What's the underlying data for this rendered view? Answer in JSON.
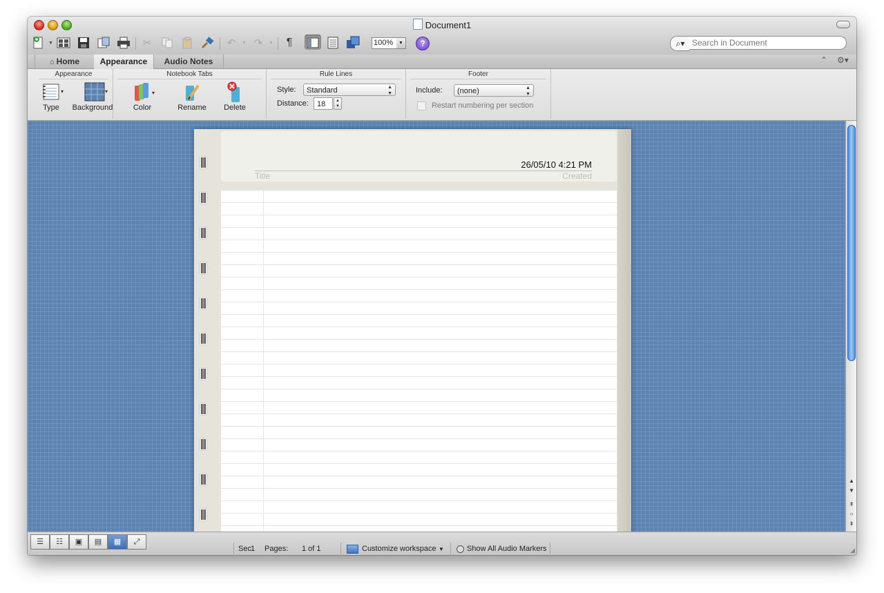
{
  "window": {
    "title": "Document1"
  },
  "toolbar": {
    "zoom": "100%",
    "help_label": "?",
    "search": {
      "placeholder": "Search in Document"
    }
  },
  "tabs": [
    {
      "label": "Home"
    },
    {
      "label": "Appearance"
    },
    {
      "label": "Audio Notes"
    }
  ],
  "ribbon": {
    "appearance": {
      "title": "Appearance",
      "type_label": "Type",
      "background_label": "Background"
    },
    "notebook_tabs": {
      "title": "Notebook Tabs",
      "color_label": "Color",
      "rename_label": "Rename",
      "delete_label": "Delete"
    },
    "rule_lines": {
      "title": "Rule Lines",
      "style_label": "Style:",
      "style_value": "Standard",
      "distance_label": "Distance:",
      "distance_value": "18"
    },
    "footer": {
      "title": "Footer",
      "include_label": "Include:",
      "include_value": "(none)",
      "restart_label": "Restart numbering per section"
    }
  },
  "page": {
    "date": "26/05/10 4:21 PM",
    "title_placeholder": "Title",
    "created_label": "Created"
  },
  "statusbar": {
    "section": "Sec",
    "section_num": "1",
    "pages_label": "Pages:",
    "pages_value": "1 of 1",
    "customize_label": "Customize workspace",
    "audio_markers_label": "Show All Audio Markers"
  },
  "colors": {
    "canvas": "#5b84b3",
    "active_view": "#3d6fb0"
  }
}
